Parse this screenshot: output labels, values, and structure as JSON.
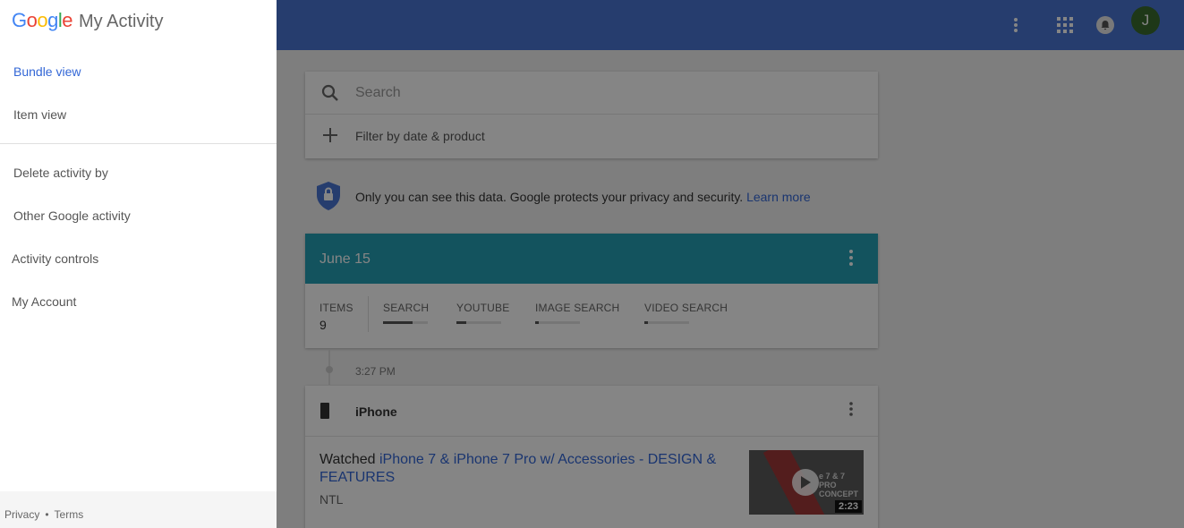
{
  "brand": {
    "google_letters": [
      "G",
      "o",
      "o",
      "g",
      "l",
      "e"
    ],
    "title": "My Activity"
  },
  "drawer": {
    "items": [
      {
        "label": "Bundle view",
        "active": true
      },
      {
        "label": "Item view",
        "active": false
      },
      {
        "label": "Delete activity by",
        "active": false
      },
      {
        "label": "Other Google activity",
        "active": false
      },
      {
        "label": "Activity controls",
        "active": false
      },
      {
        "label": "My Account",
        "active": false
      }
    ],
    "footer": {
      "privacy": "Privacy",
      "separator": "•",
      "terms": "Terms"
    }
  },
  "topbar": {
    "avatar_letter": "J",
    "color": "#4a75d4"
  },
  "search": {
    "placeholder": "Search",
    "filter_label": "Filter by date & product"
  },
  "privacy": {
    "text": "Only you can see this data. Google protects your privacy and security. ",
    "link": "Learn more"
  },
  "day": {
    "title": "June 15",
    "header_color": "#26a0b4",
    "items_label": "ITEMS",
    "items_count": "9",
    "stats": [
      {
        "label": "SEARCH",
        "fraction": 0.65
      },
      {
        "label": "YOUTUBE",
        "fraction": 0.22
      },
      {
        "label": "IMAGE SEARCH",
        "fraction": 0.08
      },
      {
        "label": "VIDEO SEARCH",
        "fraction": 0.08
      }
    ]
  },
  "entry": {
    "time": "3:27 PM",
    "device": "iPhone",
    "watched_prefix": "Watched ",
    "video_title": "iPhone 7 & iPhone 7 Pro w/ Accessories - DESIGN & FEATURES",
    "channel": "NTL",
    "thumbnail_text": "e 7 & 7 PRO CONCEPT",
    "duration": "2:23"
  }
}
